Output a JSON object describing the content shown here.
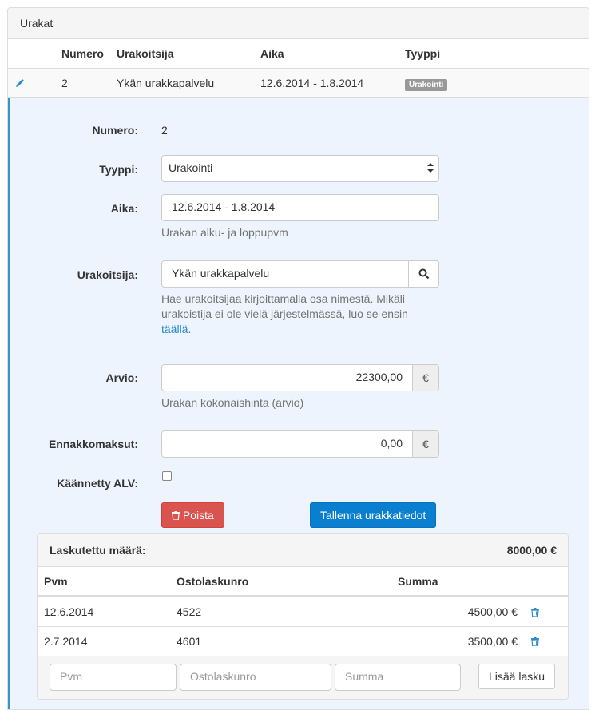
{
  "panel": {
    "title": "Urakat"
  },
  "table": {
    "headers": {
      "numero": "Numero",
      "urakoitsija": "Urakoitsija",
      "aika": "Aika",
      "tyyppi": "Tyyppi"
    },
    "row": {
      "numero": "2",
      "urakoitsija": "Ykän urakkapalvelu",
      "aika": "12.6.2014 - 1.8.2014",
      "tyyppi_badge": "Urakointi"
    }
  },
  "form": {
    "numero": {
      "label": "Numero:",
      "value": "2"
    },
    "tyyppi": {
      "label": "Tyyppi:",
      "value": "Urakointi"
    },
    "aika": {
      "label": "Aika:",
      "value": "12.6.2014 - 1.8.2014",
      "help": "Urakan alku- ja loppupvm"
    },
    "urakoitsija": {
      "label": "Urakoitsija:",
      "value": "Ykän urakkapalvelu",
      "help_line1": "Hae urakoitsijaa kirjoittamalla osa nimestä. Mikäli",
      "help_line2": "urakoistija ei ole vielä järjestelmässä, luo se ensin",
      "help_link": "täällä",
      "help_end": "."
    },
    "arvio": {
      "label": "Arvio:",
      "value": "22300,00",
      "addon": "€",
      "help": "Urakan kokonaishinta (arvio)"
    },
    "ennakko": {
      "label": "Ennakkomaksut:",
      "value": "0,00",
      "addon": "€"
    },
    "alv": {
      "label": "Käännetty ALV:",
      "checked": false
    },
    "delete_button": "Poista",
    "save_button": "Tallenna urakkatiedot"
  },
  "invoices": {
    "summary_label": "Laskutettu määrä:",
    "summary_value": "8000,00 €",
    "headers": {
      "pvm": "Pvm",
      "ostolaskunro": "Ostolaskunro",
      "summa": "Summa"
    },
    "rows": [
      {
        "pvm": "12.6.2014",
        "ostolaskunro": "4522",
        "summa": "4500,00 €"
      },
      {
        "pvm": "2.7.2014",
        "ostolaskunro": "4601",
        "summa": "3500,00 €"
      }
    ],
    "new": {
      "pvm_placeholder": "Pvm",
      "ostolaskunro_placeholder": "Ostolaskunro",
      "summa_placeholder": "Summa",
      "add_button": "Lisää lasku"
    }
  },
  "colors": {
    "accent": "#0a7fd0",
    "danger": "#d9534f",
    "edit_bg": "#edf4fd",
    "edit_border": "#3694c7",
    "badge": "#999999"
  }
}
